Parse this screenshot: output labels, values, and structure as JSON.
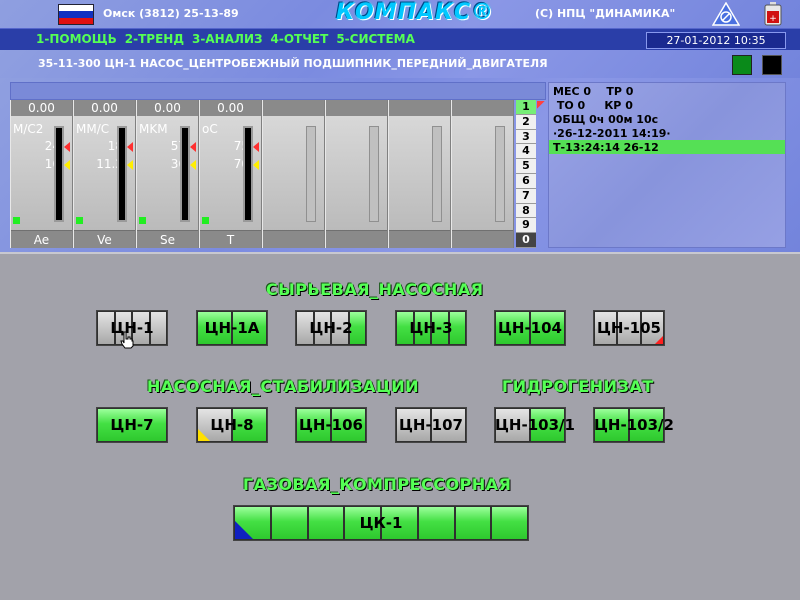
{
  "header": {
    "city_phone": "Омск (3812) 25-13-89",
    "logo": "КОМПАКС®",
    "copyright": "(С) НПЦ \"ДИНАМИКА\"",
    "icons": [
      "russia-flag",
      "warning-triangle-icon",
      "battery-icon"
    ]
  },
  "menu": {
    "items": [
      "1-ПОМОЩЬ",
      "2-ТРЕНД",
      "3-АНАЛИЗ",
      "4-ОТЧЕТ",
      "5-СИСТЕМА"
    ],
    "datetime": "27-01-2012 10:35"
  },
  "title": "35-11-300 ЦН-1 НАСОС_ЦЕНТРОБЕЖНЫЙ ПОДШИПНИК_ПЕРЕДНИЙ_ДВИГАТЕЛЯ",
  "gauges": [
    {
      "value": "0.00",
      "unit": "M/C2",
      "hi": "24",
      "lo": "16",
      "name": "Ae"
    },
    {
      "value": "0.00",
      "unit": "MM/C",
      "hi": "18",
      "lo": "11.2",
      "name": "Ve"
    },
    {
      "value": "0.00",
      "unit": "MKM",
      "hi": "57",
      "lo": "36",
      "name": "Se"
    },
    {
      "value": "0.00",
      "unit": "oC",
      "hi": "75",
      "lo": "70",
      "name": "T"
    }
  ],
  "channels": [
    "1",
    "2",
    "3",
    "4",
    "5",
    "6",
    "7",
    "8",
    "9",
    "0"
  ],
  "status": {
    "line1": "МЕС 0    ТР 0",
    "line2": " ТО 0     КР 0",
    "line3": "ОБЩ 0ч 00м 10с",
    "line4": "·26-12-2011 14:19·",
    "line5": "Т-13:24:14 26-12"
  },
  "sections": {
    "s1": "СЫРЬЕВАЯ_НАСОСНАЯ",
    "s2": "НАСОСНАЯ_СТАБИЛИЗАЦИИ",
    "s3": "ГИДРОГЕНИЗАТ",
    "s4": "ГАЗОВАЯ_КОМПРЕССОРНАЯ"
  },
  "pumps": {
    "p1": "ЦН-1",
    "p2": "ЦН-1А",
    "p3": "ЦН-2",
    "p4": "ЦН-3",
    "p5": "ЦН-104",
    "p6": "ЦН-105",
    "p7": "ЦН-7",
    "p8": "ЦН-8",
    "p9": "ЦН-106",
    "p10": "ЦН-107",
    "p11": "ЦН-103/1",
    "p12": "ЦН-103/2",
    "p13": "ЦК-1"
  },
  "colors": {
    "menu_text": "#55ff55",
    "section_text": "#55ff55",
    "ok": "#44e044",
    "off": "#c6c6c6",
    "alarm_red": "#ff2020",
    "warn_yellow": "#ffe000"
  }
}
